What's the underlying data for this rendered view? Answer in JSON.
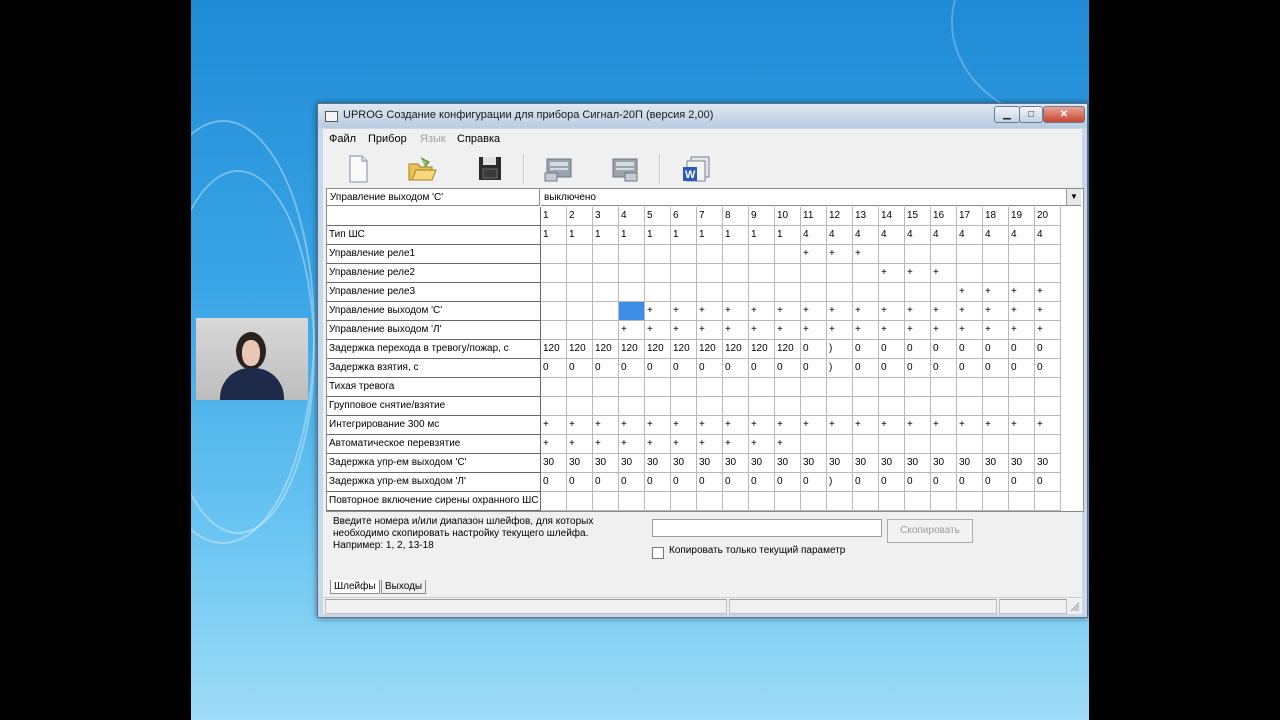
{
  "window": {
    "title": "UPROG  Создание конфигурации для прибора Сигнал-20П (версия  2,00)",
    "minimize_glyph": "▁",
    "maximize_glyph": "□",
    "close_glyph": "✕"
  },
  "menu": {
    "file": "Файл",
    "device": "Прибор",
    "language": "Язык",
    "help": "Справка"
  },
  "toolbar": {
    "icons": [
      "new-document-icon",
      "open-folder-icon",
      "save-disk-icon",
      "read-config-icon",
      "write-config-icon",
      "export-word-icon"
    ]
  },
  "top_selector": {
    "label": "Управление выходом 'С'",
    "value": "выключено",
    "arrow": "▼"
  },
  "grid": {
    "columns": [
      "1",
      "2",
      "3",
      "4",
      "5",
      "6",
      "7",
      "8",
      "9",
      "10",
      "11",
      "12",
      "13",
      "14",
      "15",
      "16",
      "17",
      "18",
      "19",
      "20"
    ],
    "rows": [
      {
        "label": "Тип ШС",
        "cells": [
          "1",
          "1",
          "1",
          "1",
          "1",
          "1",
          "1",
          "1",
          "1",
          "1",
          "4",
          "4",
          "4",
          "4",
          "4",
          "4",
          "4",
          "4",
          "4",
          "4"
        ]
      },
      {
        "label": "Управление реле1",
        "cells": [
          "",
          "",
          "",
          "",
          "",
          "",
          "",
          "",
          "",
          "",
          "+",
          "+",
          "+",
          "",
          "",
          "",
          "",
          "",
          "",
          ""
        ]
      },
      {
        "label": "Управление реле2",
        "cells": [
          "",
          "",
          "",
          "",
          "",
          "",
          "",
          "",
          "",
          "",
          "",
          "",
          "",
          "+",
          "+",
          "+",
          "",
          "",
          "",
          ""
        ]
      },
      {
        "label": "Управление реле3",
        "cells": [
          "",
          "",
          "",
          "",
          "",
          "",
          "",
          "",
          "",
          "",
          "",
          "",
          "",
          "",
          "",
          "",
          "+",
          "+",
          "+",
          "+"
        ]
      },
      {
        "label": "Управление выходом 'С'",
        "cells": [
          "",
          "",
          "",
          "",
          "+",
          "+",
          "+",
          "+",
          "+",
          "+",
          "+",
          "+",
          "+",
          "+",
          "+",
          "+",
          "+",
          "+",
          "+",
          "+"
        ]
      },
      {
        "label": "Управление выходом 'Л'",
        "cells": [
          "",
          "",
          "",
          "+",
          "+",
          "+",
          "+",
          "+",
          "+",
          "+",
          "+",
          "+",
          "+",
          "+",
          "+",
          "+",
          "+",
          "+",
          "+",
          "+"
        ]
      },
      {
        "label": "Задержка перехода в тревогу/пожар, с",
        "cells": [
          "120",
          "120",
          "120",
          "120",
          "120",
          "120",
          "120",
          "120",
          "120",
          "120",
          "0",
          ")",
          "0",
          "0",
          "0",
          "0",
          "0",
          "0",
          "0",
          "0"
        ]
      },
      {
        "label": "Задержка взятия, с",
        "cells": [
          "0",
          "0",
          "0",
          "0",
          "0",
          "0",
          "0",
          "0",
          "0",
          "0",
          "0",
          ")",
          "0",
          "0",
          "0",
          "0",
          "0",
          "0",
          "0",
          "0"
        ]
      },
      {
        "label": "Тихая тревога",
        "cells": [
          "",
          "",
          "",
          "",
          "",
          "",
          "",
          "",
          "",
          "",
          "",
          "",
          "",
          "",
          "",
          "",
          "",
          "",
          "",
          ""
        ]
      },
      {
        "label": "Групповое снятие/взятие",
        "cells": [
          "",
          "",
          "",
          "",
          "",
          "",
          "",
          "",
          "",
          "",
          "",
          "",
          "",
          "",
          "",
          "",
          "",
          "",
          "",
          ""
        ]
      },
      {
        "label": "Интегрирование 300 мс",
        "cells": [
          "+",
          "+",
          "+",
          "+",
          "+",
          "+",
          "+",
          "+",
          "+",
          "+",
          "+",
          "+",
          "+",
          "+",
          "+",
          "+",
          "+",
          "+",
          "+",
          "+"
        ]
      },
      {
        "label": "Автоматическое перевзятие",
        "cells": [
          "+",
          "+",
          "+",
          "+",
          "+",
          "+",
          "+",
          "+",
          "+",
          "+",
          "",
          "",
          "",
          "",
          "",
          "",
          "",
          "",
          "",
          ""
        ]
      },
      {
        "label": "Задержка упр-ем выходом 'С'",
        "cells": [
          "30",
          "30",
          "30",
          "30",
          "30",
          "30",
          "30",
          "30",
          "30",
          "30",
          "30",
          "30",
          "30",
          "30",
          "30",
          "30",
          "30",
          "30",
          "30",
          "30"
        ]
      },
      {
        "label": "Задержка упр-ем выходом 'Л'",
        "cells": [
          "0",
          "0",
          "0",
          "0",
          "0",
          "0",
          "0",
          "0",
          "0",
          "0",
          "0",
          ")",
          "0",
          "0",
          "0",
          "0",
          "0",
          "0",
          "0",
          "0"
        ]
      },
      {
        "label": "Повторное включение сирены охранного ШС",
        "cells": [
          "",
          "",
          "",
          "",
          "",
          "",
          "",
          "",
          "",
          "",
          "",
          "",
          "",
          "",
          "",
          "",
          "",
          "",
          "",
          ""
        ]
      }
    ],
    "selected": {
      "row": 4,
      "col": 3
    }
  },
  "copy_panel": {
    "hint_line1": "Введите номера и/или диапазон шлейфов, для которых",
    "hint_line2": "необходимо скопировать настройку текущего шлейфа.",
    "hint_line3": "Например: 1, 2, 13-18",
    "input_value": "",
    "copy_button": "Скопировать",
    "checkbox_label": "Копировать только текущий параметр"
  },
  "tabs": {
    "loops": "Шлейфы",
    "outputs": "Выходы"
  },
  "colors": {
    "selection": "#3d8ee6",
    "disabled_text": "#9b9b9b"
  }
}
